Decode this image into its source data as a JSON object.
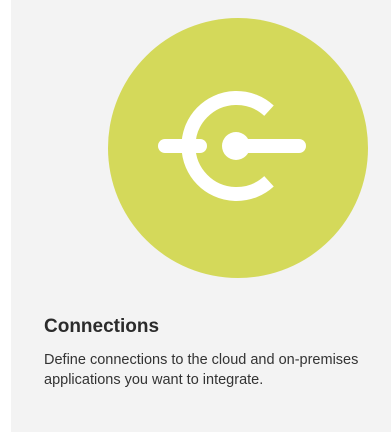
{
  "card": {
    "title": "Connections",
    "description": "Define connections to the cloud and on-premises applications you want to integrate.",
    "icon": "connection-plug-icon"
  },
  "colors": {
    "card_background": "#f3f3f3",
    "icon_circle": "#d4d95a",
    "icon_glyph": "#ffffff",
    "title_text": "#2b2b2b",
    "description_text": "#333333"
  }
}
